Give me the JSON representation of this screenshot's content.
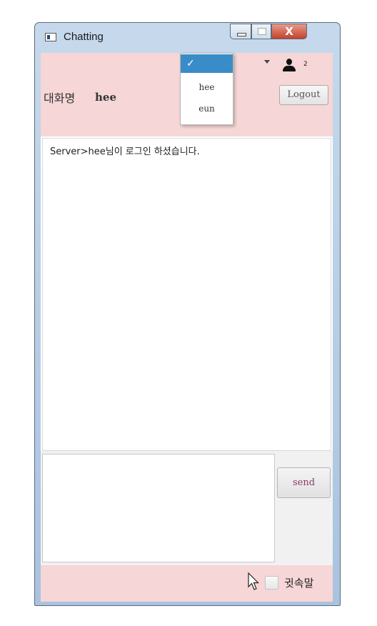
{
  "window": {
    "title": "Chatting",
    "close_glyph": "X"
  },
  "header": {
    "room_label": "대화명",
    "user_name": "hee",
    "user_count": "2",
    "logout_label": "Logout",
    "icons": {
      "people": "person-icon",
      "dropdown": "chevron-down-icon"
    }
  },
  "dropdown": {
    "selected_mark": "✓",
    "options": [
      "hee",
      "eun"
    ]
  },
  "chat": {
    "messages": [
      "Server>hee님이 로그인 하셨습니다."
    ]
  },
  "composer": {
    "value": "",
    "send_label": "send"
  },
  "footer": {
    "whisper_label": "귓속말",
    "whisper_checked": false
  },
  "colors": {
    "panel_pink": "#f6d6d6",
    "selection_blue": "#3a8cc8",
    "send_text": "#883b66"
  }
}
